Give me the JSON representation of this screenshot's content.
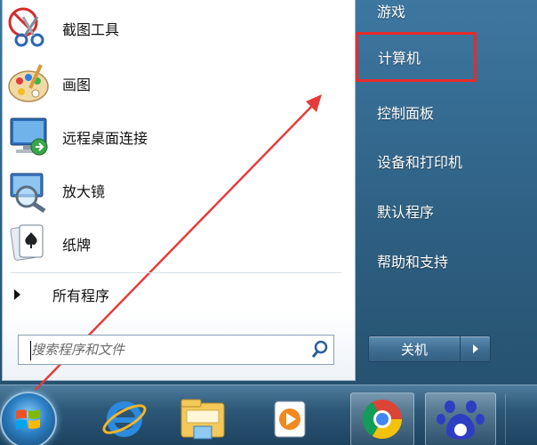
{
  "left_pane": {
    "programs": [
      {
        "label": "截图工具",
        "icon": "snipping-tool-icon"
      },
      {
        "label": "画图",
        "icon": "paint-palette-icon"
      },
      {
        "label": "远程桌面连接",
        "icon": "remote-desktop-icon"
      },
      {
        "label": "放大镜",
        "icon": "magnifier-icon"
      },
      {
        "label": "纸牌",
        "icon": "solitaire-cards-icon"
      }
    ],
    "all_programs": "所有程序",
    "search": {
      "placeholder": "搜索程序和文件",
      "value": ""
    }
  },
  "right_pane": {
    "items": [
      {
        "label": "游戏"
      },
      {
        "label": "计算机",
        "highlighted": true
      },
      {
        "label": "控制面板"
      },
      {
        "label": "设备和打印机"
      },
      {
        "label": "默认程序"
      },
      {
        "label": "帮助和支持"
      }
    ],
    "shutdown_label": "关机"
  },
  "taskbar": {
    "pinned": [
      "internet-explorer-icon",
      "file-explorer-icon",
      "media-player-icon",
      "chrome-icon",
      "baidu-icon"
    ]
  },
  "colors": {
    "highlight_border": "#e52b2b",
    "annotation_arrow": "#e63b3b"
  }
}
